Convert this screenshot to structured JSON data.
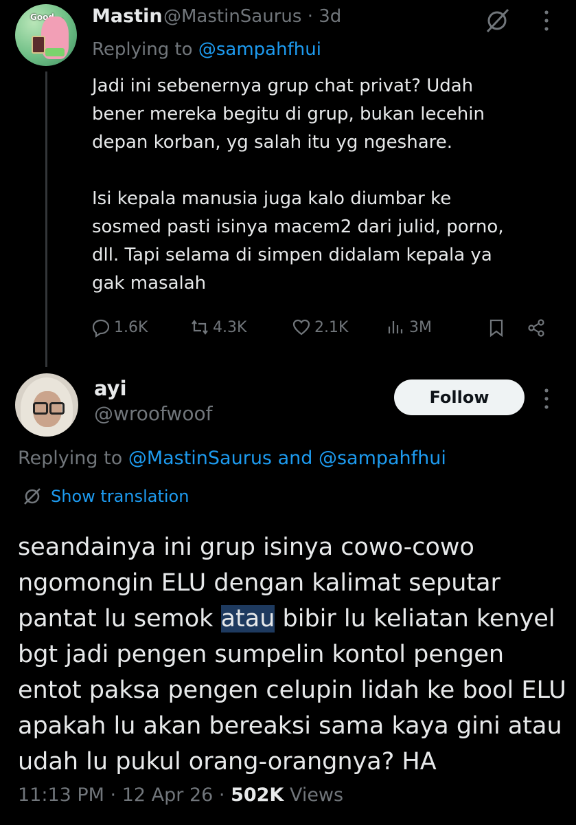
{
  "tweet1": {
    "avatar_text": "Good...",
    "name": "Mastin",
    "handle": "@MastinSaurus · 3d",
    "replying_prefix": "Replying to ",
    "replying_to": "@sampahfhui",
    "text": "Jadi ini sebenernya grup chat privat? Udah\nbener mereka begitu di grup, bukan lecehin\ndepan korban, yg salah itu yg ngeshare.\n\nIsi kepala manusia juga kalo diumbar ke\nsosmed pasti isinya macem2 dari julid, porno,\ndll. Tapi selama di simpen didalam kepala ya\ngak masalah",
    "actions": {
      "replies": "1.6K",
      "retweets": "4.3K",
      "likes": "2.1K",
      "views": "3M"
    }
  },
  "tweet2": {
    "name": "ayi",
    "handle": "@wroofwoof",
    "follow_label": "Follow",
    "replying_prefix": "Replying to ",
    "replying_to": "@MastinSaurus and @sampahfhui",
    "show_translation": "Show translation",
    "text_before": "seandainya ini grup isinya cowo-cowo ngomongin ELU dengan kalimat seputar pantat lu semok ",
    "text_highlight": "atau",
    "text_after": " bibir lu keliatan kenyel bgt jadi pengen sumpelin kontol pengen entot paksa pengen celupin lidah ke bool ELU apakah lu akan bereaksi sama kaya gini atau udah lu pukul orang-orangnya? HA",
    "time": "11:13 PM · 12 Apr 26 · ",
    "views_count": "502K",
    "views_label": " Views"
  },
  "colors": {
    "accent": "#1d9bf0",
    "muted": "#71767b",
    "text": "#e7e9ea",
    "background": "#000000"
  }
}
